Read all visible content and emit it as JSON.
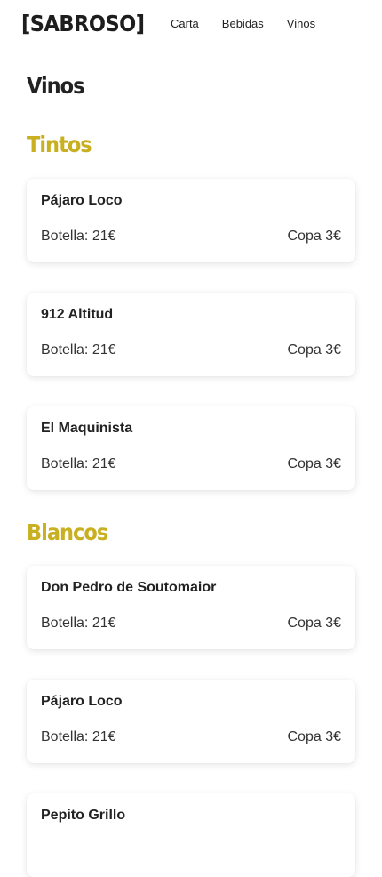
{
  "header": {
    "logo": "[SABROSO]",
    "nav": [
      "Carta",
      "Bebidas",
      "Vinos"
    ]
  },
  "page": {
    "title": "Vinos"
  },
  "colors": {
    "accent": "#c9b020",
    "text": "#222222"
  },
  "sections": [
    {
      "title": "Tintos",
      "items": [
        {
          "name": "Pájaro Loco",
          "bottle": "Botella: 21€",
          "glass": "Copa 3€"
        },
        {
          "name": "912 Altitud",
          "bottle": "Botella: 21€",
          "glass": "Copa 3€"
        },
        {
          "name": "El Maquinista",
          "bottle": "Botella: 21€",
          "glass": "Copa 3€"
        }
      ]
    },
    {
      "title": "Blancos",
      "items": [
        {
          "name": "Don Pedro de Soutomaior",
          "bottle": "Botella: 21€",
          "glass": "Copa 3€"
        },
        {
          "name": "Pájaro Loco",
          "bottle": "Botella: 21€",
          "glass": "Copa 3€"
        },
        {
          "name": "Pepito Grillo",
          "bottle": "",
          "glass": ""
        }
      ]
    }
  ]
}
